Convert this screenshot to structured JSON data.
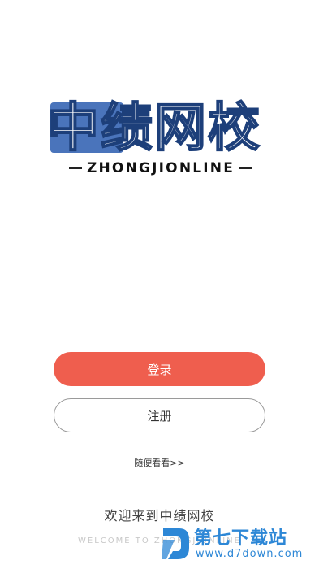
{
  "logo": {
    "chinese": "中绩网校",
    "english": "ZHONGJIONLINE",
    "colors": {
      "primary": "#4a74bb",
      "outline": "#1d3f7a"
    }
  },
  "actions": {
    "login_label": "登录",
    "register_label": "注册",
    "browse_label": "随便看看>>"
  },
  "welcome": {
    "title": "欢迎来到中绩网校",
    "subtitle": "WELCOME TO ZHONGJIONLINE"
  },
  "watermark": {
    "name": "第七下载站",
    "url": "www.d7down.com",
    "icon": "d7-logo-icon",
    "color": "#2d87d6"
  },
  "colors": {
    "accent": "#ef5e4e",
    "background": "#ffffff"
  }
}
